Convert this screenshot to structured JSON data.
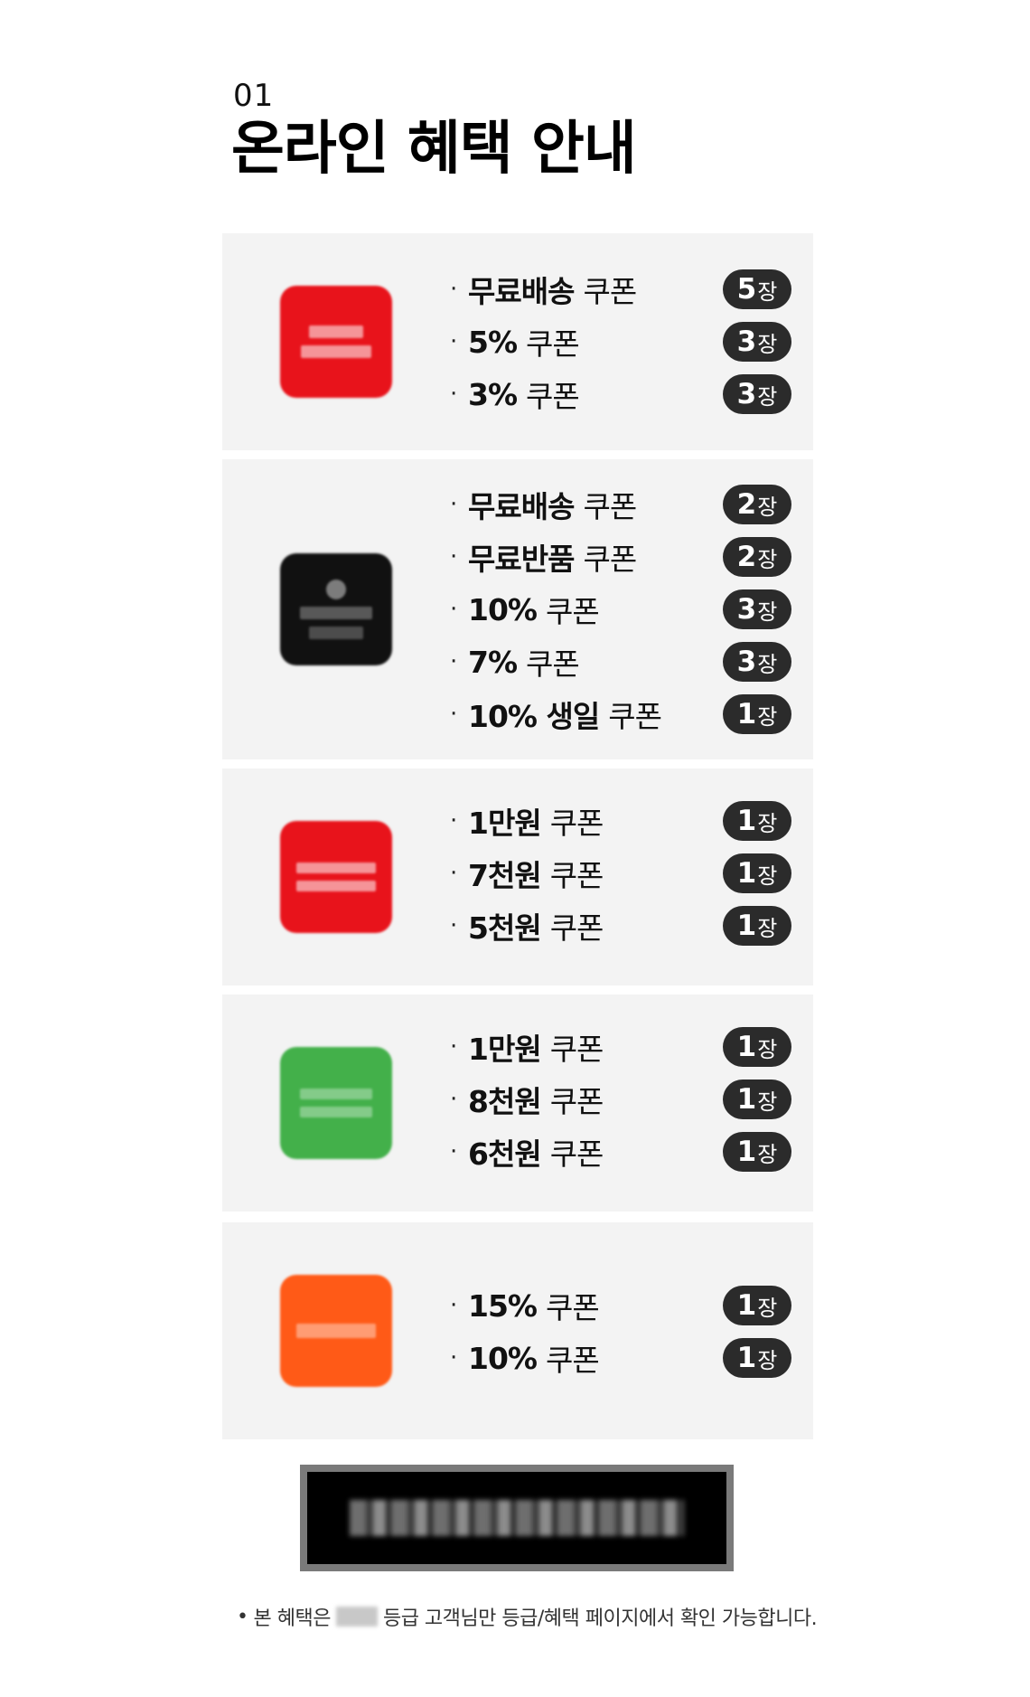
{
  "section": {
    "number": "01",
    "title": "온라인 혜택 안내"
  },
  "colors": {
    "panel_bg": "#f3f3f3",
    "badge_bg": "#2b2b2b",
    "cta_bg": "#000000"
  },
  "badge_unit": "장",
  "coupon_word": "쿠폰",
  "groups": [
    {
      "logo_color": "#e8131b",
      "items": [
        {
          "name": "무료배송",
          "count": "5"
        },
        {
          "name": "5%",
          "count": "3"
        },
        {
          "name": "3%",
          "count": "3"
        }
      ]
    },
    {
      "logo_color": "#111111",
      "items": [
        {
          "name": "무료배송",
          "count": "2"
        },
        {
          "name": "무료반품",
          "count": "2"
        },
        {
          "name": "10%",
          "count": "3"
        },
        {
          "name": "7%",
          "count": "3"
        },
        {
          "name": "10% 생일",
          "count": "1"
        }
      ]
    },
    {
      "logo_color": "#e8131b",
      "items": [
        {
          "name": "1만원",
          "count": "1"
        },
        {
          "name": "7천원",
          "count": "1"
        },
        {
          "name": "5천원",
          "count": "1"
        }
      ]
    },
    {
      "logo_color": "#43b04a",
      "items": [
        {
          "name": "1만원",
          "count": "1"
        },
        {
          "name": "8천원",
          "count": "1"
        },
        {
          "name": "6천원",
          "count": "1"
        }
      ]
    },
    {
      "logo_color": "#ff5a17",
      "items": [
        {
          "name": "15%",
          "count": "1"
        },
        {
          "name": "10%",
          "count": "1"
        }
      ]
    }
  ],
  "note": {
    "bullet": "•",
    "prefix": "본 혜택은",
    "suffix": "등급 고객님만 등급/혜택 페이지에서 확인 가능합니다."
  }
}
